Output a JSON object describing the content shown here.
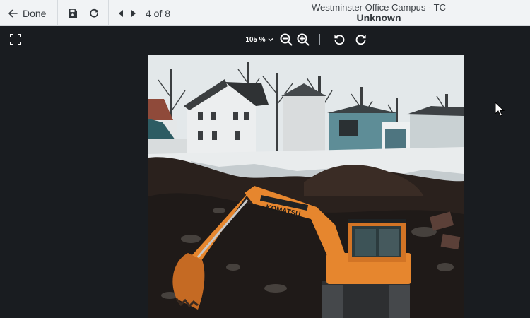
{
  "topbar": {
    "done_label": "Done",
    "counter": "4 of 8",
    "title": "Westminster Office Campus - TC",
    "subtitle": "Unknown"
  },
  "icons": {
    "back": "arrow-left-icon",
    "save": "floppy-disk-icon",
    "refresh": "refresh-icon",
    "prev": "caret-left-icon",
    "next": "caret-right-icon",
    "fullscreen": "fullscreen-icon",
    "zoom_out": "zoom-out-icon",
    "zoom_in": "zoom-in-icon",
    "rotate_left": "rotate-left-icon",
    "rotate_right": "rotate-right-icon"
  },
  "viewer": {
    "zoom_level": "105 %"
  },
  "colors": {
    "topbar_bg": "#f1f3f5",
    "viewer_bg": "#191c20",
    "excavator": "#e6862e"
  }
}
